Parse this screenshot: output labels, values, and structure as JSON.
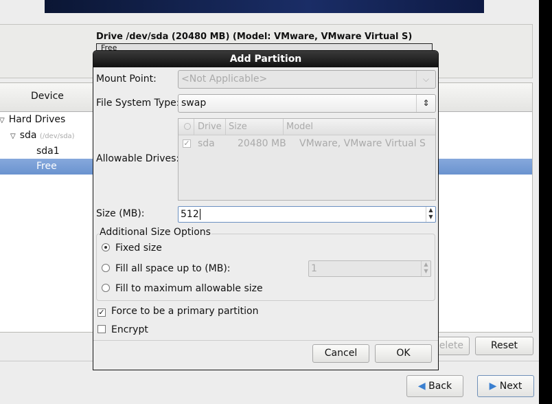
{
  "drive": {
    "label": "Drive /dev/sda (20480 MB) (Model: VMware, VMware Virtual S)",
    "bar_text": "Free"
  },
  "tree": {
    "header": "Device",
    "items": [
      {
        "label": "Hard Drives"
      },
      {
        "label": "sda",
        "sub": "(/dev/sda)"
      },
      {
        "label": "sda1"
      },
      {
        "label": "Free",
        "selected": true
      }
    ]
  },
  "buttons": {
    "delete": "Delete",
    "reset": "Reset",
    "back": "Back",
    "next": "Next"
  },
  "dialog": {
    "title": "Add Partition",
    "mount_label": "Mount Point:",
    "mount_value": "<Not Applicable>",
    "fs_label": "File System Type:",
    "fs_value": "swap",
    "drives_label": "Allowable Drives:",
    "drives_columns": [
      "Drive",
      "Size",
      "Model"
    ],
    "drives_rows": [
      {
        "checked": true,
        "drive": "sda",
        "size": "20480 MB",
        "model": "VMware, VMware Virtual S"
      }
    ],
    "size_label": "Size (MB):",
    "size_value": "512",
    "options_legend": "Additional Size Options",
    "opt_fixed": "Fixed size",
    "opt_fill_upto": "Fill all space up to (MB):",
    "fill_upto_value": "1",
    "opt_fill_max": "Fill to maximum allowable size",
    "selected_option": "Fixed size",
    "primary_label": "Force to be a primary partition",
    "primary_checked": true,
    "encrypt_label": "Encrypt",
    "encrypt_checked": false,
    "cancel": "Cancel",
    "ok": "OK"
  },
  "colors": {
    "selection": "#7a9fd6",
    "title_bar": "#1e1e1e"
  }
}
